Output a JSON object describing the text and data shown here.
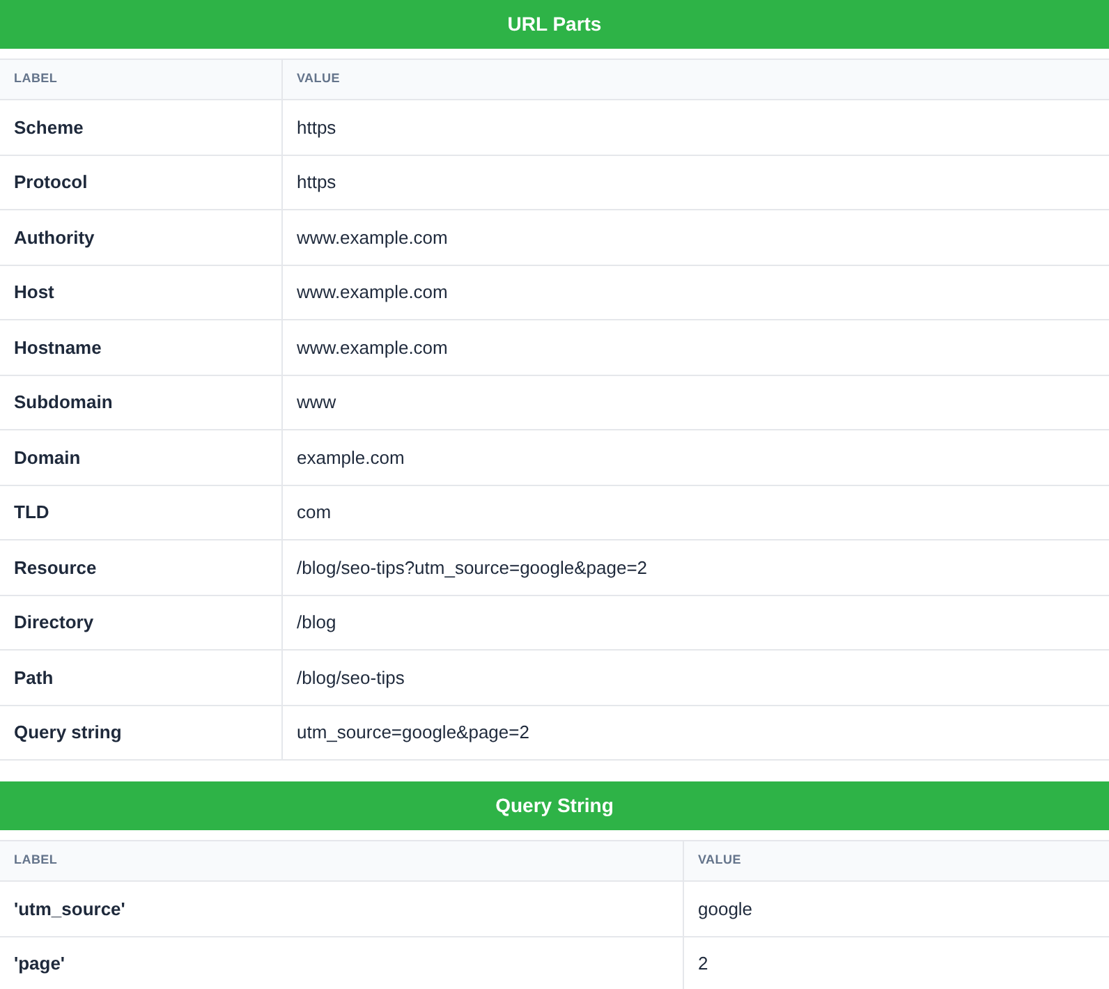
{
  "sections": [
    {
      "title": "URL Parts",
      "columns": [
        "LABEL",
        "VALUE"
      ],
      "rows": [
        {
          "label": "Scheme",
          "value": "https"
        },
        {
          "label": "Protocol",
          "value": "https"
        },
        {
          "label": "Authority",
          "value": "www.example.com"
        },
        {
          "label": "Host",
          "value": "www.example.com"
        },
        {
          "label": "Hostname",
          "value": "www.example.com"
        },
        {
          "label": "Subdomain",
          "value": "www"
        },
        {
          "label": "Domain",
          "value": "example.com"
        },
        {
          "label": "TLD",
          "value": "com"
        },
        {
          "label": "Resource",
          "value": "/blog/seo-tips?utm_source=google&page=2"
        },
        {
          "label": "Directory",
          "value": "/blog"
        },
        {
          "label": "Path",
          "value": "/blog/seo-tips"
        },
        {
          "label": "Query string",
          "value": "utm_source=google&page=2"
        }
      ]
    },
    {
      "title": "Query String",
      "columns": [
        "LABEL",
        "VALUE"
      ],
      "rows": [
        {
          "label": "'utm_source'",
          "value": "google"
        },
        {
          "label": "'page'",
          "value": "2"
        }
      ]
    }
  ]
}
